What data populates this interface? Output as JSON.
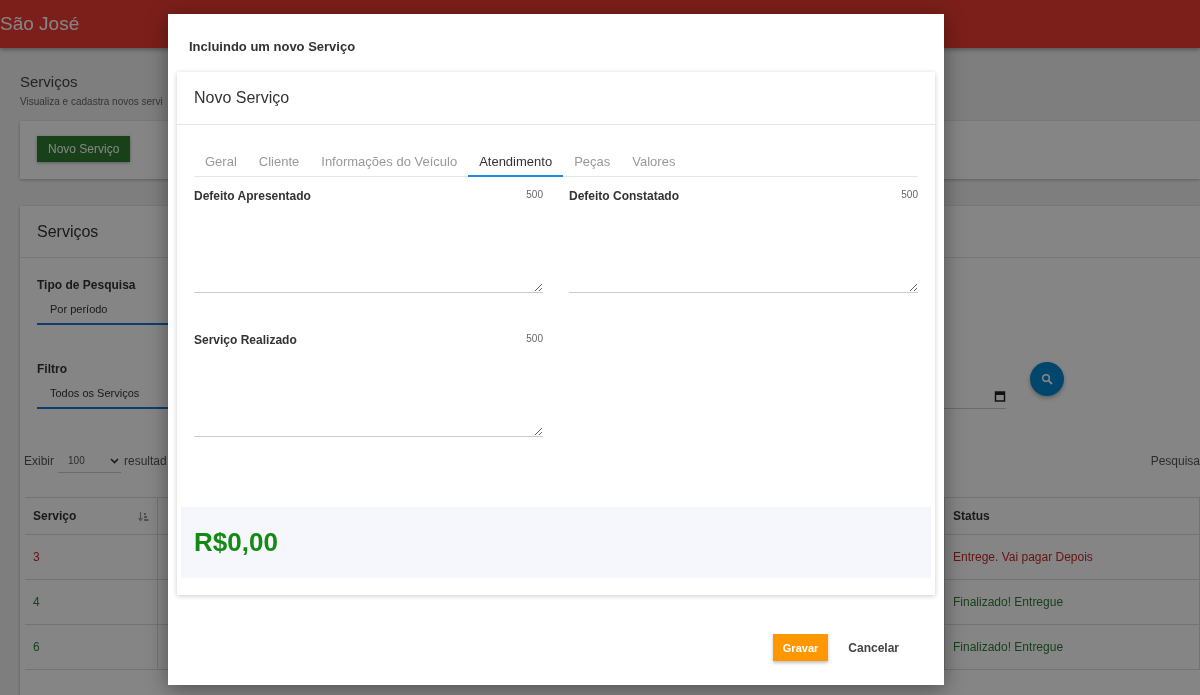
{
  "header": {
    "title": "São José"
  },
  "page": {
    "title": "Serviços",
    "subtitle": "Visualiza e cadastra novos servi",
    "new_button": "Novo Serviço"
  },
  "services_card": {
    "title": "Serviços",
    "search_type": {
      "label": "Tipo de Pesquisa",
      "value": "Por período"
    },
    "filter": {
      "label": "Filtro",
      "value": "Todos os Serviços"
    },
    "show": {
      "label": "Exibir",
      "value": "100",
      "suffix": "resultad"
    },
    "search_label": "Pesquisa"
  },
  "table": {
    "columns": [
      "Serviço",
      "Status"
    ],
    "rows": [
      {
        "service": "3",
        "status": "Entrege. Vai pagar Depois",
        "kind": "pending"
      },
      {
        "service": "4",
        "status": "Finalizado! Entregue",
        "kind": "done"
      },
      {
        "service": "6",
        "status": "Finalizado! Entregue",
        "kind": "done"
      }
    ]
  },
  "dialog": {
    "title": "Incluindo um novo Serviço",
    "card_title": "Novo Serviço",
    "tabs": [
      {
        "label": "Geral",
        "selected": false
      },
      {
        "label": "Cliente",
        "selected": false
      },
      {
        "label": "Informações do Veículo",
        "selected": false
      },
      {
        "label": "Atendimento",
        "selected": true
      },
      {
        "label": "Peças",
        "selected": false
      },
      {
        "label": "Valores",
        "selected": false
      }
    ],
    "fields": [
      {
        "label": "Defeito Apresentado",
        "counter": "500"
      },
      {
        "label": "Defeito Constatado",
        "counter": "500"
      },
      {
        "label": "Serviço Realizado",
        "counter": "500"
      }
    ],
    "total": "R$0,00",
    "buttons": [
      {
        "label": "Gravar",
        "kind": "primary"
      },
      {
        "label": "Cancelar",
        "kind": "flat"
      }
    ]
  }
}
